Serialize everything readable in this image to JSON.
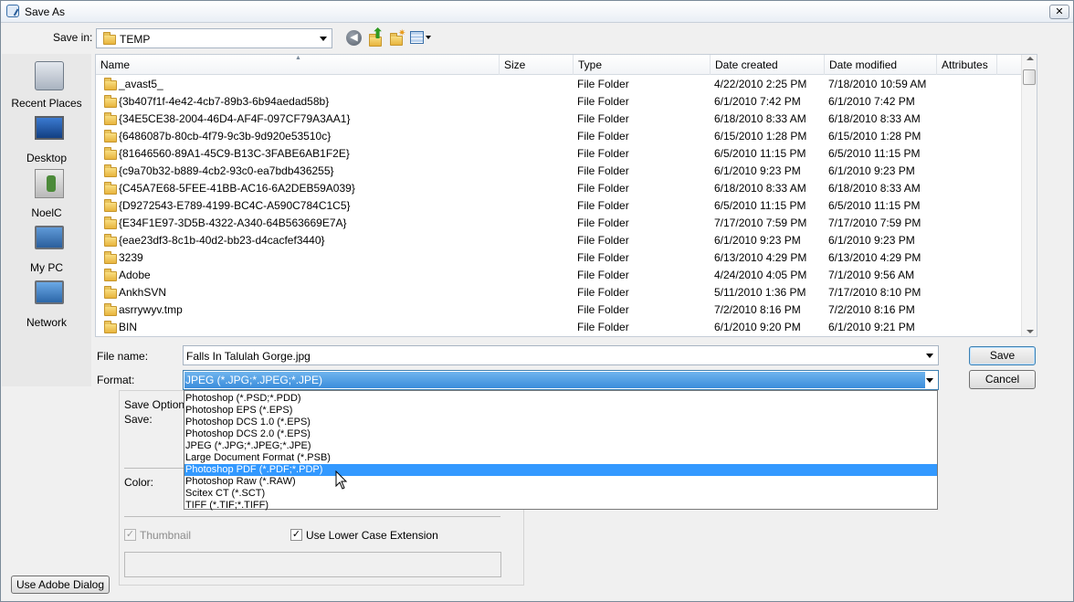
{
  "window": {
    "title": "Save As",
    "close_glyph": "✕"
  },
  "save_in": {
    "label": "Save in:",
    "value": "TEMP"
  },
  "toolbar": {
    "back_icon": "back-arrow-icon",
    "up_icon": "up-folder-icon",
    "new_folder_icon": "new-folder-icon",
    "view_icon": "view-menu-icon"
  },
  "places": [
    {
      "label": "Recent Places",
      "icon": "recent-places-icon"
    },
    {
      "label": "Desktop",
      "icon": "desktop-icon"
    },
    {
      "label": "NoelC",
      "icon": "user-folder-icon"
    },
    {
      "label": "My PC",
      "icon": "computer-icon"
    },
    {
      "label": "Network",
      "icon": "network-icon"
    }
  ],
  "columns": [
    "Name",
    "Size",
    "Type",
    "Date created",
    "Date modified",
    "Attributes"
  ],
  "files": [
    {
      "name": "_avast5_",
      "size": "",
      "type": "File Folder",
      "created": "4/22/2010 2:25 PM",
      "modified": "7/18/2010 10:59 AM",
      "attributes": ""
    },
    {
      "name": "{3b407f1f-4e42-4cb7-89b3-6b94aedad58b}",
      "size": "",
      "type": "File Folder",
      "created": "6/1/2010 7:42 PM",
      "modified": "6/1/2010 7:42 PM",
      "attributes": ""
    },
    {
      "name": "{34E5CE38-2004-46D4-AF4F-097CF79A3AA1}",
      "size": "",
      "type": "File Folder",
      "created": "6/18/2010 8:33 AM",
      "modified": "6/18/2010 8:33 AM",
      "attributes": ""
    },
    {
      "name": "{6486087b-80cb-4f79-9c3b-9d920e53510c}",
      "size": "",
      "type": "File Folder",
      "created": "6/15/2010 1:28 PM",
      "modified": "6/15/2010 1:28 PM",
      "attributes": ""
    },
    {
      "name": "{81646560-89A1-45C9-B13C-3FABE6AB1F2E}",
      "size": "",
      "type": "File Folder",
      "created": "6/5/2010 11:15 PM",
      "modified": "6/5/2010 11:15 PM",
      "attributes": ""
    },
    {
      "name": "{c9a70b32-b889-4cb2-93c0-ea7bdb436255}",
      "size": "",
      "type": "File Folder",
      "created": "6/1/2010 9:23 PM",
      "modified": "6/1/2010 9:23 PM",
      "attributes": ""
    },
    {
      "name": "{C45A7E68-5FEE-41BB-AC16-6A2DEB59A039}",
      "size": "",
      "type": "File Folder",
      "created": "6/18/2010 8:33 AM",
      "modified": "6/18/2010 8:33 AM",
      "attributes": ""
    },
    {
      "name": "{D9272543-E789-4199-BC4C-A590C784C1C5}",
      "size": "",
      "type": "File Folder",
      "created": "6/5/2010 11:15 PM",
      "modified": "6/5/2010 11:15 PM",
      "attributes": ""
    },
    {
      "name": "{E34F1E97-3D5B-4322-A340-64B563669E7A}",
      "size": "",
      "type": "File Folder",
      "created": "7/17/2010 7:59 PM",
      "modified": "7/17/2010 7:59 PM",
      "attributes": ""
    },
    {
      "name": "{eae23df3-8c1b-40d2-bb23-d4cacfef3440}",
      "size": "",
      "type": "File Folder",
      "created": "6/1/2010 9:23 PM",
      "modified": "6/1/2010 9:23 PM",
      "attributes": ""
    },
    {
      "name": "3239",
      "size": "",
      "type": "File Folder",
      "created": "6/13/2010 4:29 PM",
      "modified": "6/13/2010 4:29 PM",
      "attributes": ""
    },
    {
      "name": "Adobe",
      "size": "",
      "type": "File Folder",
      "created": "4/24/2010 4:05 PM",
      "modified": "7/1/2010 9:56 AM",
      "attributes": ""
    },
    {
      "name": "AnkhSVN",
      "size": "",
      "type": "File Folder",
      "created": "5/11/2010 1:36 PM",
      "modified": "7/17/2010 8:10 PM",
      "attributes": ""
    },
    {
      "name": "asrrywyv.tmp",
      "size": "",
      "type": "File Folder",
      "created": "7/2/2010 8:16 PM",
      "modified": "7/2/2010 8:16 PM",
      "attributes": ""
    },
    {
      "name": "BIN",
      "size": "",
      "type": "File Folder",
      "created": "6/1/2010 9:20 PM",
      "modified": "6/1/2010 9:21 PM",
      "attributes": ""
    }
  ],
  "file_name": {
    "label": "File name:",
    "value": "Falls In Talulah Gorge.jpg"
  },
  "format": {
    "label": "Format:",
    "value": "JPEG (*.JPG;*.JPEG;*.JPE)",
    "options": [
      "Photoshop (*.PSD;*.PDD)",
      "Photoshop EPS (*.EPS)",
      "Photoshop DCS 1.0 (*.EPS)",
      "Photoshop DCS 2.0 (*.EPS)",
      "JPEG (*.JPG;*.JPEG;*.JPE)",
      "Large Document Format (*.PSB)",
      "Photoshop PDF (*.PDF;*.PDP)",
      "Photoshop Raw (*.RAW)",
      "Scitex CT (*.SCT)",
      "TIFF (*.TIF;*.TIFF)"
    ],
    "highlighted": "Photoshop PDF (*.PDF;*.PDP)"
  },
  "buttons": {
    "save": "Save",
    "cancel": "Cancel",
    "adobe_dialog": "Use Adobe Dialog"
  },
  "save_options": {
    "title": "Save Option",
    "save_label": "Save:",
    "color_label": "Color:",
    "thumbnail": {
      "label": "Thumbnail",
      "checked": true,
      "enabled": false
    },
    "lower_case": {
      "label": "Use Lower Case Extension",
      "checked": true,
      "enabled": true
    },
    "check_glyph": "✓"
  }
}
